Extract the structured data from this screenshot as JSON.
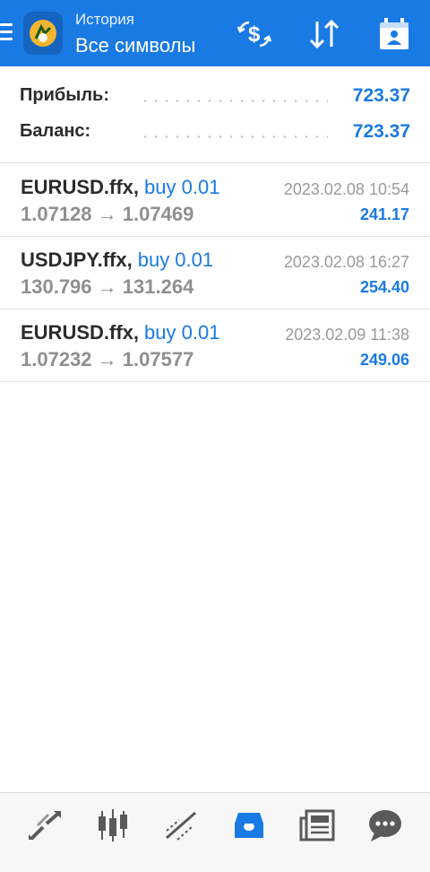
{
  "header": {
    "subtitle": "История",
    "title": "Все символы"
  },
  "summary": [
    {
      "label": "Прибыль:",
      "value": "723.37"
    },
    {
      "label": "Баланс:",
      "value": "723.37"
    }
  ],
  "deals": [
    {
      "symbol": "EURUSD.ffx",
      "type": "buy 0.01",
      "open": "1.07128",
      "close": "1.07469",
      "time": "2023.02.08 10:54",
      "profit": "241.17"
    },
    {
      "symbol": "USDJPY.ffx",
      "type": "buy 0.01",
      "open": "130.796",
      "close": "131.264",
      "time": "2023.02.08 16:27",
      "profit": "254.40"
    },
    {
      "symbol": "EURUSD.ffx",
      "type": "buy 0.01",
      "open": "1.07232",
      "close": "1.07577",
      "time": "2023.02.09 11:38",
      "profit": "249.06"
    }
  ],
  "symbols": {
    "separator": ",",
    "arrow": "→"
  },
  "colors": {
    "accent": "#1a7ae4",
    "text": "#2b2b2b",
    "muted": "#8f8f8f"
  },
  "icons": {
    "header": [
      "menu-icon",
      "app-logo",
      "currency-exchange-icon",
      "sort-icon",
      "calendar-icon"
    ],
    "nav": [
      "quotes-icon",
      "chart-icon",
      "trade-icon",
      "history-icon",
      "news-icon",
      "chat-icon"
    ]
  },
  "nav": {
    "active": "history"
  }
}
